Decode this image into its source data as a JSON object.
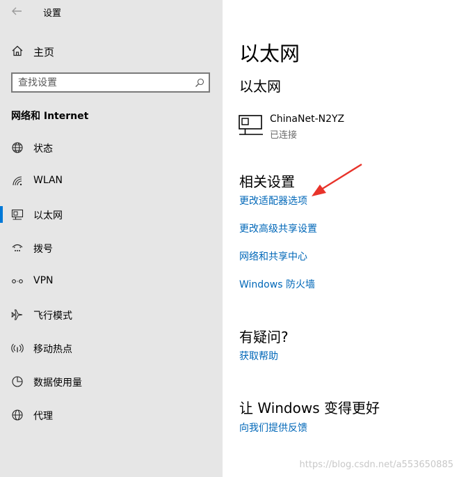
{
  "window": {
    "title": "设置"
  },
  "sidebar": {
    "home_label": "主页",
    "search_placeholder": "查找设置",
    "section_title": "网络和 Internet",
    "items": [
      {
        "label": "状态",
        "icon": "globe-icon"
      },
      {
        "label": "WLAN",
        "icon": "wifi-icon"
      },
      {
        "label": "以太网",
        "icon": "ethernet-icon",
        "active": true
      },
      {
        "label": "拨号",
        "icon": "dialup-icon"
      },
      {
        "label": "VPN",
        "icon": "vpn-icon"
      },
      {
        "label": "飞行模式",
        "icon": "airplane-icon"
      },
      {
        "label": "移动热点",
        "icon": "hotspot-icon"
      },
      {
        "label": "数据使用量",
        "icon": "data-usage-icon"
      },
      {
        "label": "代理",
        "icon": "proxy-globe-icon"
      }
    ]
  },
  "main": {
    "page_title": "以太网",
    "sub_title": "以太网",
    "network": {
      "name": "ChinaNet-N2YZ",
      "status": "已连接"
    },
    "related": {
      "title": "相关设置",
      "links": [
        "更改适配器选项",
        "更改高级共享设置",
        "网络和共享中心",
        "Windows 防火墙"
      ]
    },
    "help": {
      "title": "有疑问?",
      "link": "获取帮助"
    },
    "feedback": {
      "title": "让 Windows 变得更好",
      "link": "向我们提供反馈"
    }
  },
  "watermark": "https://blog.csdn.net/a553650885",
  "colors": {
    "accent": "#0078d7",
    "link": "#0067b8",
    "sidebar_bg": "#e6e6e6",
    "annotation_arrow": "#e8332a"
  }
}
